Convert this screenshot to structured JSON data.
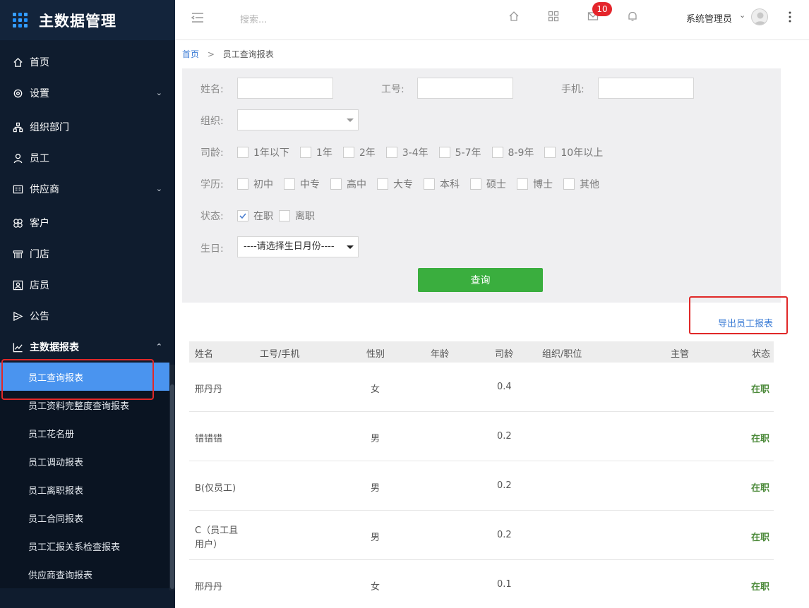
{
  "app": {
    "title": "主数据管理"
  },
  "sidebar": {
    "items": [
      {
        "label": "首页",
        "icon": "home-icon"
      },
      {
        "label": "设置",
        "icon": "gear-icon",
        "has_children": true
      },
      {
        "label": "组织部门",
        "icon": "org-icon"
      },
      {
        "label": "员工",
        "icon": "user-icon"
      },
      {
        "label": "供应商",
        "icon": "supplier-icon",
        "has_children": true
      },
      {
        "label": "客户",
        "icon": "customer-icon"
      },
      {
        "label": "门店",
        "icon": "store-icon"
      },
      {
        "label": "店员",
        "icon": "clerk-icon"
      },
      {
        "label": "公告",
        "icon": "announcement-icon"
      },
      {
        "label": "主数据报表",
        "icon": "chart-line-icon",
        "expanded": true
      }
    ],
    "sub_items": [
      {
        "label": "员工查询报表",
        "active": true
      },
      {
        "label": "员工资料完整度查询报表"
      },
      {
        "label": "员工花名册"
      },
      {
        "label": "员工调动报表"
      },
      {
        "label": "员工离职报表"
      },
      {
        "label": "员工合同报表"
      },
      {
        "label": "员工汇报关系检查报表"
      },
      {
        "label": "供应商查询报表"
      }
    ]
  },
  "header": {
    "search_placeholder": "搜索...",
    "mail_badge": "10",
    "user_name": "系统管理员"
  },
  "breadcrumb": {
    "home": "首页",
    "sep": ">",
    "current": "员工查询报表"
  },
  "filters": {
    "name_label": "姓名:",
    "id_label": "工号:",
    "phone_label": "手机:",
    "org_label": "组织:",
    "tenure_label": "司龄:",
    "tenure_options": [
      "1年以下",
      "1年",
      "2年",
      "3-4年",
      "5-7年",
      "8-9年",
      "10年以上"
    ],
    "edu_label": "学历:",
    "edu_options": [
      "初中",
      "中专",
      "高中",
      "大专",
      "本科",
      "硕士",
      "博士",
      "其他"
    ],
    "status_label": "状态:",
    "status_options": [
      {
        "label": "在职",
        "checked": true
      },
      {
        "label": "离职",
        "checked": false
      }
    ],
    "birthday_label": "生日:",
    "birthday_select": "----请选择生日月份----",
    "query_button": "查询"
  },
  "export_link": "导出员工报表",
  "table": {
    "headers": [
      "姓名",
      "工号/手机",
      "性别",
      "年龄",
      "司龄",
      "组织/职位",
      "主管",
      "状态"
    ],
    "rows": [
      {
        "name": "邢丹丹",
        "gender": "女",
        "tenure": "0.4",
        "status": "在职"
      },
      {
        "name": "错错错",
        "gender": "男",
        "tenure": "0.2",
        "status": "在职"
      },
      {
        "name": "B(仅员工)",
        "gender": "男",
        "tenure": "0.2",
        "status": "在职"
      },
      {
        "name": "C（员工且用户）",
        "name_line1": "C（员工且",
        "name_line2": "用户）",
        "gender": "男",
        "tenure": "0.2",
        "status": "在职"
      },
      {
        "name": "邢丹丹",
        "gender": "女",
        "tenure": "0.1",
        "status": "在职"
      }
    ]
  }
}
